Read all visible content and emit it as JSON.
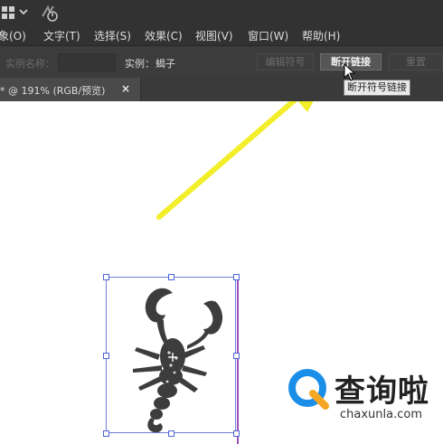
{
  "menu": {
    "items": [
      {
        "label": "象(O)"
      },
      {
        "label": "文字(T)"
      },
      {
        "label": "选择(S)"
      },
      {
        "label": "效果(C)"
      },
      {
        "label": "视图(V)"
      },
      {
        "label": "窗口(W)"
      },
      {
        "label": "帮助(H)"
      }
    ]
  },
  "control_bar": {
    "instance_name_label": "实例名称：",
    "instance_label": "实例：",
    "instance_value": "蝎子",
    "edit_symbol_label": "编辑符号",
    "break_link_label": "断开链接",
    "reset_label": "重置"
  },
  "tooltip": {
    "text": "断开符号链接"
  },
  "document_tab": {
    "label": "* @ 191% (RGB/预览)",
    "close": "×"
  },
  "watermark": {
    "title": "查询啦",
    "url": "chaxunla.com"
  },
  "colors": {
    "arrow": "#f2ee2a",
    "selection": "#4d64d6",
    "artboard_edge": "#9a52b8",
    "watermark_blue": "#1b8fe8",
    "watermark_orange": "#f5a623"
  }
}
